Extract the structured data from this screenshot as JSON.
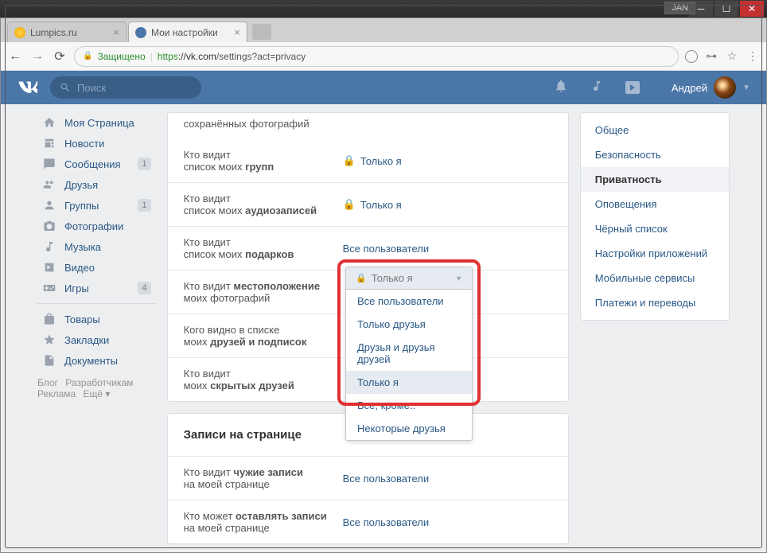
{
  "window": {
    "jan": "JAN"
  },
  "tabs": {
    "t1": "Lumpics.ru",
    "t2": "Мои настройки"
  },
  "addrbar": {
    "secure": "Защищено",
    "proto": "https",
    "domain": "://vk.com",
    "path": "/settings?act=privacy"
  },
  "header": {
    "search": "Поиск",
    "user": "Андрей"
  },
  "leftnav": {
    "mypage": "Моя Страница",
    "news": "Новости",
    "messages": "Сообщения",
    "msg_badge": "1",
    "friends": "Друзья",
    "groups": "Группы",
    "groups_badge": "1",
    "photos": "Фотографии",
    "music": "Музыка",
    "video": "Видео",
    "games": "Игры",
    "games_badge": "4",
    "market": "Товары",
    "bookmarks": "Закладки",
    "docs": "Документы",
    "blog": "Блог",
    "devs": "Разработчикам",
    "ads": "Реклама",
    "more": "Ещё"
  },
  "settings": {
    "row0": "сохранённых фотографий",
    "row1_a": "Кто видит",
    "row1_b": "список моих ",
    "row1_c": "групп",
    "row1_v": "Только я",
    "row2_a": "Кто видит",
    "row2_b": "список моих ",
    "row2_c": "аудиозаписей",
    "row2_v": "Только я",
    "row3_a": "Кто видит",
    "row3_b": "список моих ",
    "row3_c": "подарков",
    "row3_v": "Все пользователи",
    "row4_a": "Кто видит ",
    "row4_b": "местоположение",
    "row4_c": "моих фотографий",
    "row5_a": "Кого видно в списке",
    "row5_b": "моих ",
    "row5_c": "друзей и подписок",
    "row6_a": "Кто видит",
    "row6_b": "моих ",
    "row6_c": "скрытых друзей",
    "section2": "Записи на странице",
    "row7_a": "Кто видит ",
    "row7_b": "чужие записи",
    "row7_c": "на моей странице",
    "row7_v": "Все пользователи",
    "row8_a": "Кто может ",
    "row8_b": "оставлять записи",
    "row8_c": "на моей странице",
    "row8_v": "Все пользователи"
  },
  "dropdown": {
    "selected": "Только я",
    "opt1": "Все пользователи",
    "opt2": "Только друзья",
    "opt3": "Друзья и друзья друзей",
    "opt4": "Только я",
    "opt5": "Все, кроме..",
    "opt6": "Некоторые друзья"
  },
  "rightnav": {
    "general": "Общее",
    "security": "Безопасность",
    "privacy": "Приватность",
    "notif": "Оповещения",
    "blacklist": "Чёрный список",
    "apps": "Настройки приложений",
    "mobile": "Мобильные сервисы",
    "payments": "Платежи и переводы"
  }
}
